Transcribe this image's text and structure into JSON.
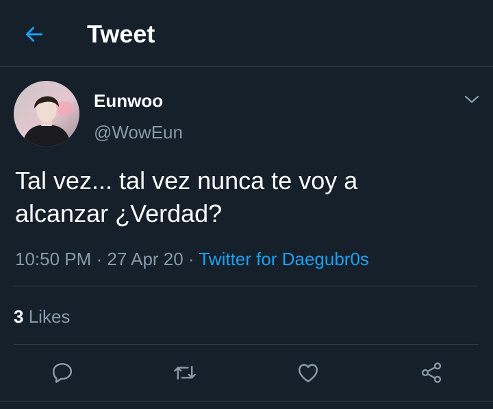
{
  "header": {
    "title": "Tweet",
    "back_icon": "arrow-left-icon",
    "accent_color": "#1da1f2"
  },
  "author": {
    "name": "Eunwoo",
    "handle": "@WowEun",
    "avatar": "profile-photo"
  },
  "tweet": {
    "line1": "Tal vez... tal vez nunca te voy a",
    "line2": "alcanzar ¿Verdad?",
    "time": "10:50 PM",
    "date": "27 Apr 20",
    "separator": " · ",
    "source": "Twitter for Daegubr0s"
  },
  "stats": {
    "likes_count": "3",
    "likes_label": "Likes"
  },
  "actions": [
    "reply-icon",
    "retweet-icon",
    "like-icon",
    "share-icon"
  ],
  "colors": {
    "background": "#15202b",
    "secondary_text": "#8899a6",
    "divider": "#38444d"
  }
}
